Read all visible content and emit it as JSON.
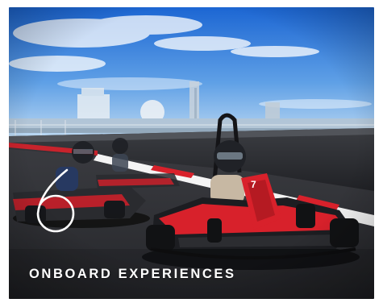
{
  "card": {
    "number": "6",
    "title": "ONBOARD EXPERIENCES",
    "image_alt": "Go-kart racing track on a cruise ship deck"
  },
  "kart": {
    "number": "7"
  },
  "colors": {
    "sky_top": "#1f6fd6",
    "sky_bottom": "#bcd8f2",
    "track": "#2e2f33",
    "accent_red": "#d8212b",
    "caption": "#ffffff"
  }
}
